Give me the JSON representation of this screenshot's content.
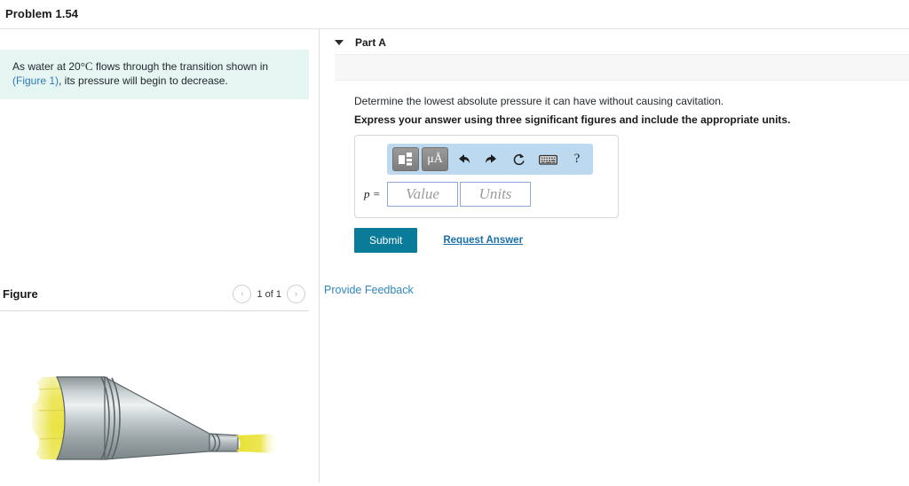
{
  "page": {
    "title": "Problem 1.54"
  },
  "problem": {
    "text_before_symbol": "As water at 20",
    "degree_symbol": "°",
    "unit_symbol": "C",
    "text_middle": " flows through the transition shown in ",
    "figure_link": "(Figure 1)",
    "text_after": ", its pressure will begin to decrease."
  },
  "figure": {
    "label": "Figure",
    "counter": "1 of 1",
    "prev_arrow": "‹",
    "next_arrow": "›"
  },
  "part": {
    "caret_icon": "triangle-down-icon",
    "title": "Part A",
    "question": "Determine the lowest absolute pressure it can have without causing cavitation.",
    "instruction": "Express your answer using three significant figures and include the appropriate units."
  },
  "answer": {
    "variable_label": "p =",
    "value_placeholder": "Value",
    "value_text": "",
    "units_placeholder": "Units",
    "units_text": "",
    "toolbar": {
      "template_icon": "math-template-icon",
      "units_icon": "μÅ",
      "undo_icon": "←",
      "redo_icon": "→",
      "reset_icon": "↺",
      "keyboard_icon": "keyboard-icon",
      "help_icon": "?"
    }
  },
  "actions": {
    "submit_label": "Submit",
    "request_answer_label": "Request Answer",
    "provide_feedback_label": "Provide Feedback"
  },
  "colors": {
    "statement_bg": "#e4f5f2",
    "link_blue": "#2f7bb5",
    "submit_teal": "#0a7c99",
    "toolbar_blue": "#bcd9ef",
    "fluid_yellow": "#e9e24a",
    "pipe_gray": "#b9c0c2"
  }
}
